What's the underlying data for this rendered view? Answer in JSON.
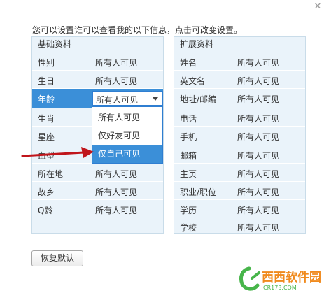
{
  "dialog": {
    "close_glyph": "✕",
    "intro_text": "您可以设置谁可以查看我的以下信息，点击可改变设置。"
  },
  "basic_panel": {
    "title": "基础资料",
    "rows": [
      {
        "label": "性别",
        "value": "所有人可见"
      },
      {
        "label": "生日",
        "value": "所有人可见"
      },
      {
        "label": "年龄",
        "value": "所有人可见"
      },
      {
        "label": "生肖",
        "value": ""
      },
      {
        "label": "星座",
        "value": ""
      },
      {
        "label": "血型",
        "value": ""
      },
      {
        "label": "所在地",
        "value": "所有人可见"
      },
      {
        "label": "故乡",
        "value": "所有人可见"
      },
      {
        "label": "Q龄",
        "value": "所有人可见"
      }
    ]
  },
  "ext_panel": {
    "title": "扩展资料",
    "rows": [
      {
        "label": "姓名",
        "value": "所有人可见"
      },
      {
        "label": "英文名",
        "value": "所有人可见"
      },
      {
        "label": "地址/邮编",
        "value": "所有人可见"
      },
      {
        "label": "电话",
        "value": "所有人可见"
      },
      {
        "label": "手机",
        "value": "所有人可见"
      },
      {
        "label": "邮箱",
        "value": "所有人可见"
      },
      {
        "label": "主页",
        "value": "所有人可见"
      },
      {
        "label": "职业/职位",
        "value": "所有人可见"
      },
      {
        "label": "学历",
        "value": "所有人可见"
      },
      {
        "label": "学校",
        "value": "所有人可见"
      }
    ]
  },
  "visibility_dropdown": {
    "selected": "所有人可见",
    "options": [
      "所有人可见",
      "仅好友可见",
      "仅自己可见"
    ],
    "highlighted_option": "仅自己可见"
  },
  "footer": {
    "reset_label": "恢复默认"
  },
  "watermark": {
    "logo_text": "西西软件园",
    "site_text": "CR173.COM"
  },
  "colors": {
    "accent": "#3b8fd8",
    "panel_bg": "#eaf3fa",
    "annotation_arrow": "#c0151b",
    "watermark_orange": "#f08a1d",
    "watermark_green": "#47b54a"
  }
}
